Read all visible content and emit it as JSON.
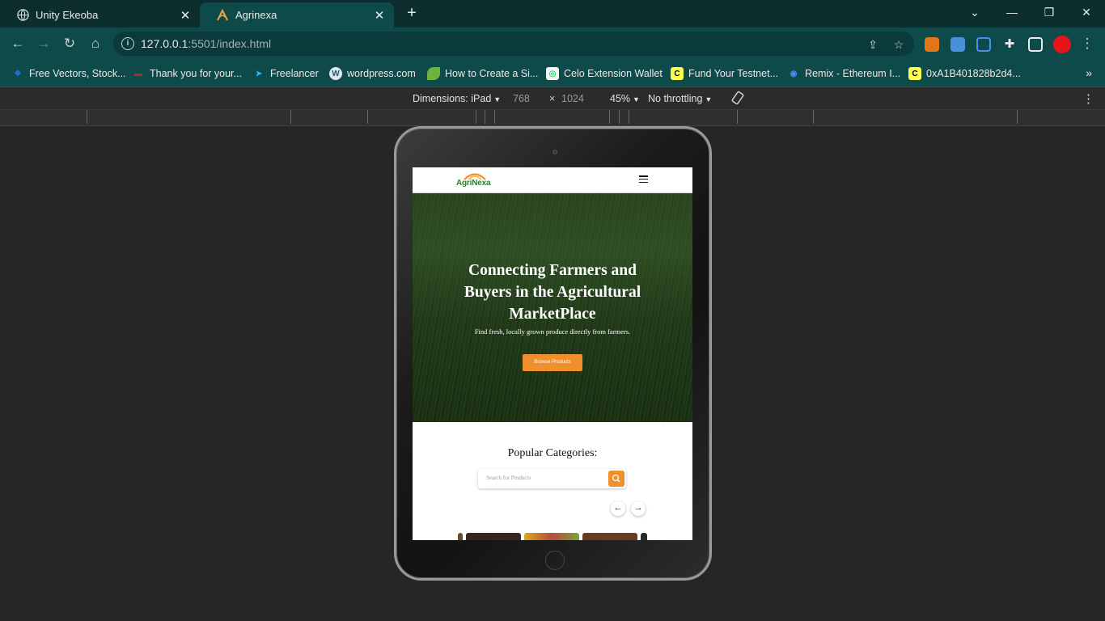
{
  "browser": {
    "tabs": [
      {
        "label": "Unity Ekeoba",
        "icon": "globe-icon",
        "active": false
      },
      {
        "label": "Agrinexa",
        "icon": "agrinexa-logo-icon",
        "active": true
      }
    ],
    "new_tab": "+",
    "window_controls": {
      "tablist": "⌄",
      "minimize": "—",
      "restore": "❐",
      "close": "✕"
    },
    "url": {
      "host": "127.0.0.1",
      "rest": ":5501/index.html"
    },
    "bookmarks": [
      {
        "label": "Free Vectors, Stock...",
        "icon": "freepik-icon",
        "color": "#1a73e8"
      },
      {
        "label": "Thank you for your...",
        "icon": "envato-icon",
        "color": "#b02a30"
      },
      {
        "label": "Freelancer",
        "icon": "freelancer-icon",
        "color": "#29b2fe"
      },
      {
        "label": "wordpress.com",
        "icon": "wordpress-icon",
        "color": "#dfe6ea"
      },
      {
        "label": "How to Create a Si...",
        "icon": "leaf-icon",
        "color": "#6db33f"
      },
      {
        "label": "Celo Extension Wallet",
        "icon": "celo-icon",
        "color": "#f5f5f5"
      },
      {
        "label": "Fund Your Testnet...",
        "icon": "c-icon",
        "color": "#fcff52"
      },
      {
        "label": "Remix - Ethereum I...",
        "icon": "remix-icon",
        "color": "#2b6fc5"
      },
      {
        "label": "0xA1B401828b2d4...",
        "icon": "c-icon",
        "color": "#fcff52"
      }
    ],
    "bookmarks_more": "»"
  },
  "device_toolbar": {
    "dimensions_label": "Dimensions: iPad",
    "width": "768",
    "times": "×",
    "height": "1024",
    "zoom": "45%",
    "throttling": "No throttling"
  },
  "site": {
    "logo": {
      "part1": "Agri",
      "part2": "Nexa"
    },
    "hero_title": "Connecting Farmers and Buyers in the Agricultural MarketPlace",
    "hero_subtitle": "Find fresh, locally grown produce directly from farmers.",
    "hero_button": "Browse Products",
    "categories_title": "Popular Categories:",
    "search_placeholder": "Search for Products",
    "prev_arrow": "←",
    "next_arrow": "→"
  },
  "colors": {
    "accent": "#f0902c",
    "browser_chrome": "#0f4a4b",
    "brand_green": "#2f7a2f"
  }
}
